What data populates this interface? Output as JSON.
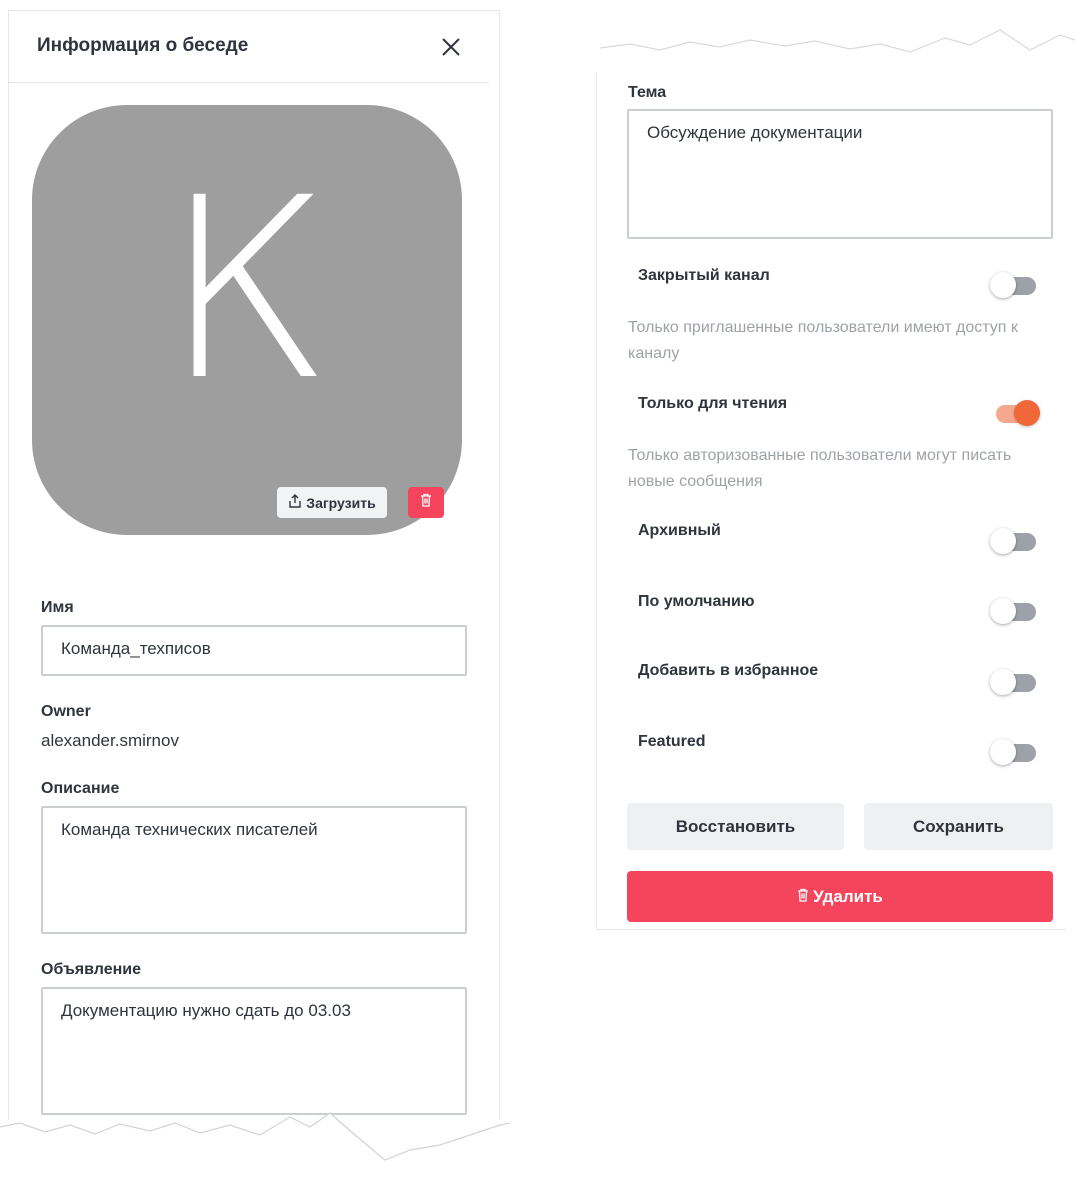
{
  "left": {
    "title": "Информация о беседе",
    "avatar_letter": "К",
    "upload_label": "Загрузить",
    "name_label": "Имя",
    "name_value": "Команда_техписов",
    "owner_label": "Owner",
    "owner_value": "alexander.smirnov",
    "description_label": "Описание",
    "description_value": "Команда технических писателей",
    "announcement_label": "Объявление",
    "announcement_value": "Документацию нужно сдать до 03.03"
  },
  "right": {
    "topic_label": "Тема",
    "topic_value": "Обсуждение документации",
    "toggles": [
      {
        "label": "Закрытый канал",
        "on": false,
        "hint": "Только приглашенные пользователи имеют доступ к каналу"
      },
      {
        "label": "Только для чтения",
        "on": true,
        "hint": "Только авторизованные пользователи могут писать новые сообщения"
      },
      {
        "label": "Архивный",
        "on": false
      },
      {
        "label": "По умолчанию",
        "on": false
      },
      {
        "label": "Добавить в избранное",
        "on": false
      },
      {
        "label": "Featured",
        "on": false
      }
    ],
    "reset_label": "Восстановить",
    "save_label": "Сохранить",
    "delete_label": "Удалить"
  },
  "colors": {
    "accent_toggle": "#f0683a",
    "danger": "#f5455c",
    "avatar_bg": "#9e9e9e"
  },
  "icons": [
    "close-icon",
    "upload-icon",
    "trash-icon"
  ]
}
